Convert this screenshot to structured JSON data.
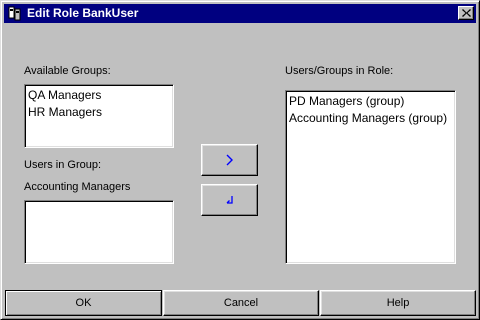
{
  "window": {
    "title": "Edit Role BankUser"
  },
  "available_groups": {
    "label": "Available Groups:",
    "items": [
      "QA Managers",
      "HR Managers"
    ]
  },
  "users_in_group": {
    "label": "Users in Group:",
    "group_name": "Accounting Managers",
    "items": []
  },
  "users_groups_in_role": {
    "label": "Users/Groups in Role:",
    "items": [
      "PD Managers (group)",
      "Accounting Managers (group)"
    ]
  },
  "buttons": {
    "ok": "OK",
    "cancel": "Cancel",
    "help": "Help"
  },
  "icons": {
    "app": "keys-icon",
    "close": "close-icon",
    "add": "arrow-right-icon",
    "remove": "arrow-down-left-icon"
  },
  "colors": {
    "titlebar": "#000080",
    "face": "#c0c0c0",
    "arrow": "#0000ff"
  }
}
